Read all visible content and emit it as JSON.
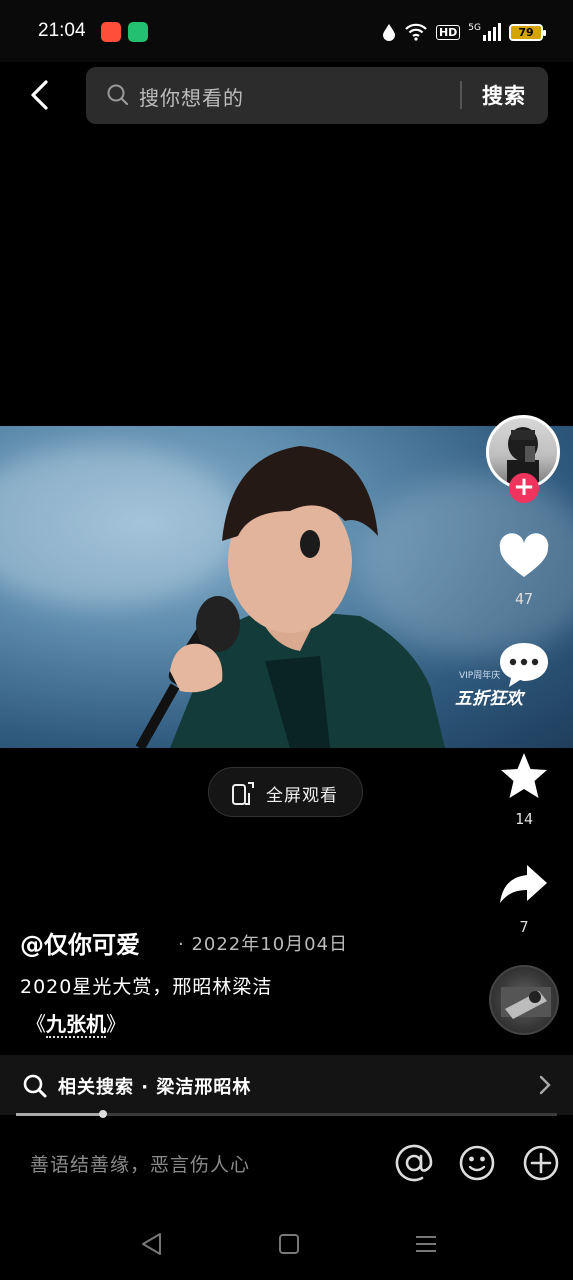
{
  "status_bar": {
    "time": "21:04",
    "battery": "79",
    "hd": "HD",
    "network": "5G"
  },
  "search": {
    "placeholder": "搜你想看的",
    "button_label": "搜索"
  },
  "video": {
    "overlay_brand": "五折狂欢",
    "overlay_small": "VIP周年庆"
  },
  "fullscreen_label": "全屏观看",
  "actions": {
    "likes": "47",
    "favorites": "14",
    "shares": "7"
  },
  "post": {
    "author": "@仅你可爱",
    "date": "· 2022年10月04日",
    "description": "2020星光大赏，邢昭林梁洁",
    "song_prefix": "《",
    "song_title": "九张机",
    "song_suffix": "》"
  },
  "related": {
    "label": "相关搜索 · 梁洁邢昭林"
  },
  "progress": 0.16,
  "comment": {
    "placeholder": "善语结善缘，恶言伤人心"
  },
  "colors": {
    "accent": "#f0345e",
    "background": "#000000"
  }
}
